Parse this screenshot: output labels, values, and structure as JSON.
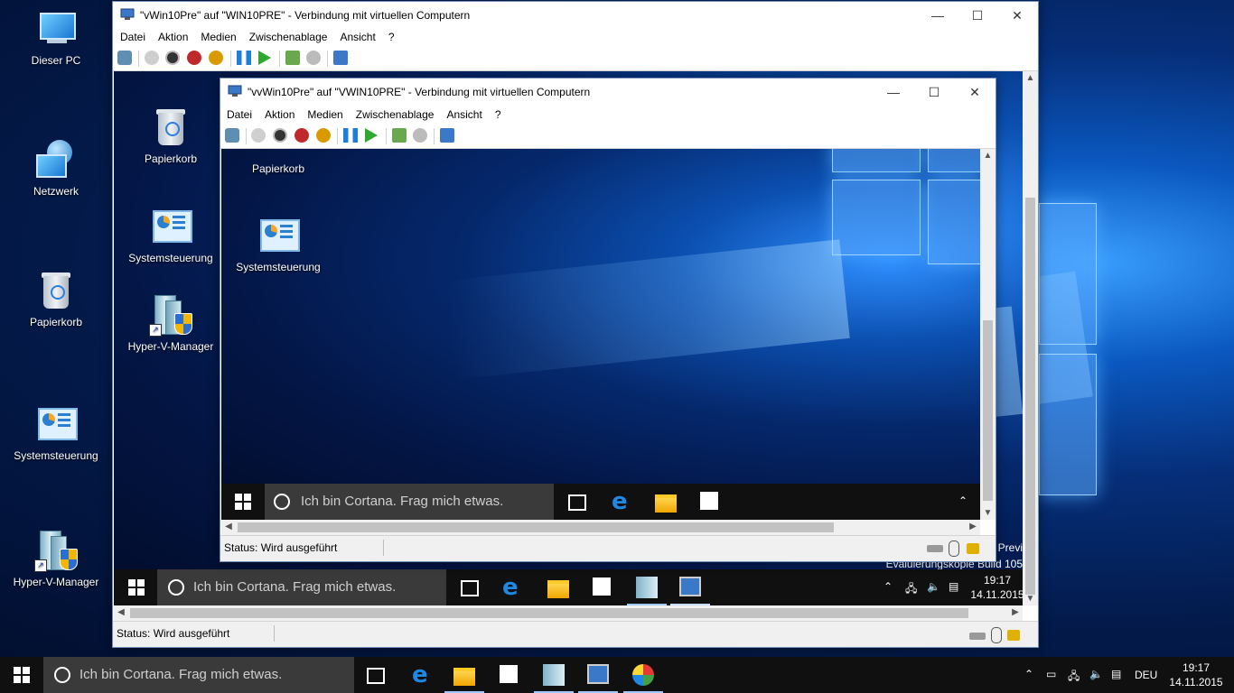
{
  "desktop": {
    "icons": [
      {
        "label": "Dieser PC"
      },
      {
        "label": "Netzwerk"
      },
      {
        "label": "Papierkorb"
      },
      {
        "label": "Systemsteuerung"
      },
      {
        "label": "Hyper-V-Manager"
      }
    ]
  },
  "outer_vm": {
    "title": "\"vWin10Pre\" auf \"WIN10PRE\" - Verbindung mit virtuellen Computern",
    "menu": [
      "Datei",
      "Aktion",
      "Medien",
      "Zwischenablage",
      "Ansicht",
      "?"
    ],
    "desktop_icons": [
      {
        "label": "Papierkorb"
      },
      {
        "label": "Systemsteuerung"
      },
      {
        "label": "Hyper-V-Manager"
      }
    ],
    "watermark": [
      "Previ",
      "Evaluierungskopie Build 105"
    ],
    "search_placeholder": "Ich bin Cortana. Frag mich etwas.",
    "clock": {
      "time": "19:17",
      "date": "14.11.2015"
    },
    "status": "Status: Wird ausgeführt"
  },
  "inner_vm": {
    "title": "\"vvWin10Pre\" auf \"VWIN10PRE\" - Verbindung mit virtuellen Computern",
    "menu": [
      "Datei",
      "Aktion",
      "Medien",
      "Zwischenablage",
      "Ansicht",
      "?"
    ],
    "desktop_icons": [
      {
        "label": "Papierkorb"
      },
      {
        "label": "Systemsteuerung"
      }
    ],
    "search_placeholder": "Ich bin Cortana. Frag mich etwas.",
    "status": "Status: Wird ausgeführt"
  },
  "host_taskbar": {
    "search_placeholder": "Ich bin Cortana. Frag mich etwas.",
    "language": "DEU",
    "clock": {
      "time": "19:17",
      "date": "14.11.2015"
    }
  },
  "window_controls": {
    "minimize": "—",
    "maximize": "☐",
    "close": "✕"
  },
  "colors": {
    "accent": "#1e88e5",
    "taskbar": "#101010",
    "search_box": "#3a3a3a",
    "stop_red": "#c0292c",
    "pause_blue": "#1e7fd8",
    "start_green": "#2fa82f",
    "power_orange": "#d99a00"
  }
}
